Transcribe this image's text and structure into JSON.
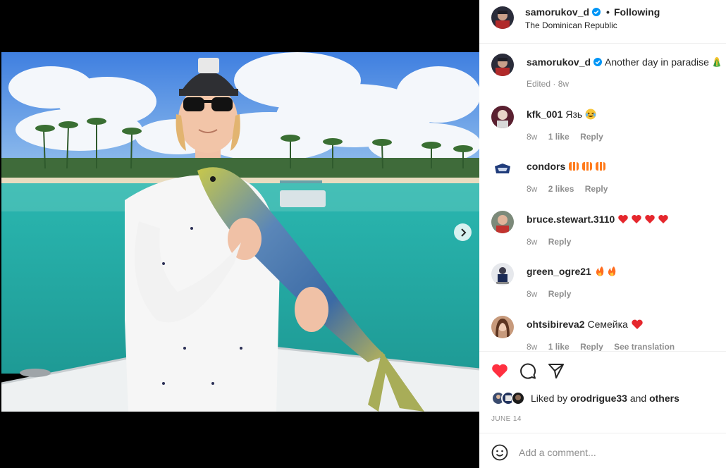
{
  "post": {
    "author": "samorukov_d",
    "location": "The Dominican Republic",
    "following_label": "Following",
    "separator": "•",
    "caption": "Another day in paradise",
    "caption_meta": "Edited · 8w"
  },
  "comments": [
    {
      "user": "kfk_001",
      "text": "Язь",
      "time": "8w",
      "likes": "1 like",
      "reply": "Reply",
      "extra": ""
    },
    {
      "user": "condors",
      "text": "",
      "time": "8w",
      "likes": "2 likes",
      "reply": "Reply",
      "extra": ""
    },
    {
      "user": "bruce.stewart.3110",
      "text": "",
      "time": "8w",
      "likes": "",
      "reply": "Reply",
      "extra": ""
    },
    {
      "user": "green_ogre21",
      "text": "",
      "time": "8w",
      "likes": "",
      "reply": "Reply",
      "extra": ""
    },
    {
      "user": "ohtsibireva2",
      "text": "Семейка",
      "time": "8w",
      "likes": "1 like",
      "reply": "Reply",
      "extra": "See translation"
    }
  ],
  "footer": {
    "liked_by_prefix": "Liked by",
    "liked_by_user": "orodrigue33",
    "liked_by_and": "and",
    "liked_by_others": "others",
    "date": "JUNE 14",
    "comment_placeholder": "Add a comment..."
  },
  "icons": {
    "like": "heart-icon",
    "comment": "comment-icon",
    "share": "share-icon",
    "emoji": "smile-icon",
    "next": "chevron-right-icon",
    "verified": "verified-badge-icon"
  },
  "colors": {
    "like_red": "#ff3040",
    "verified_blue": "#0095f6",
    "muted": "#8e8e8e"
  }
}
